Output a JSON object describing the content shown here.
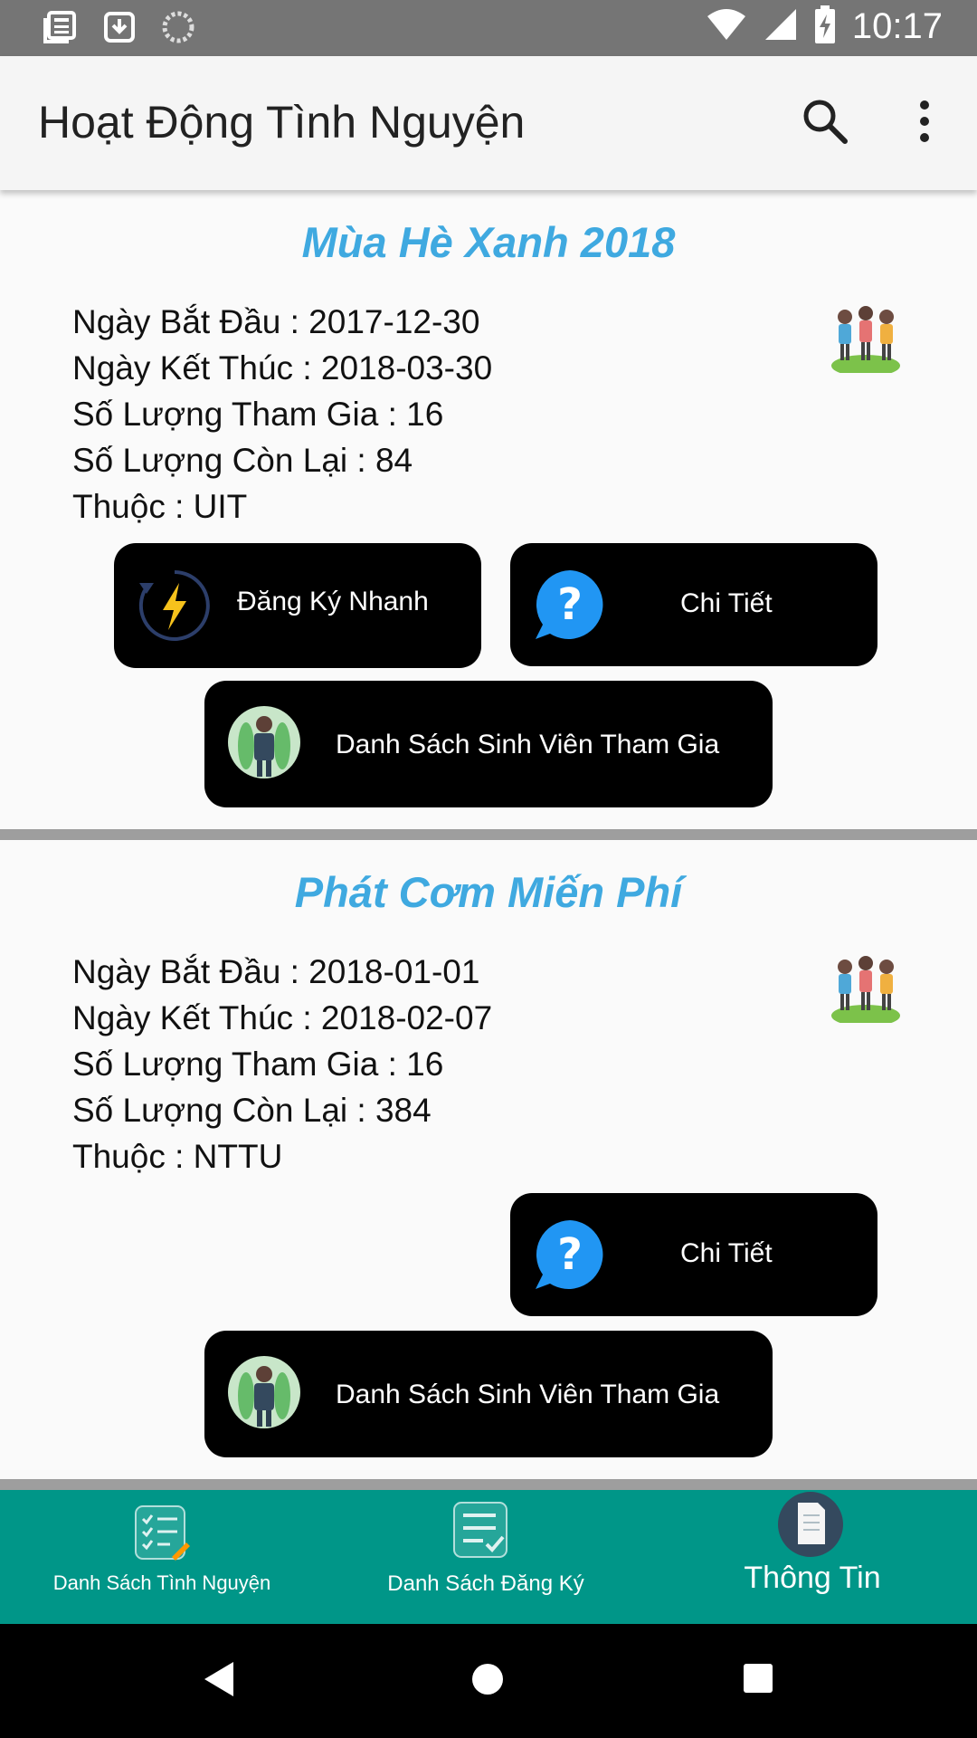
{
  "status_bar": {
    "time": "10:17",
    "icons": [
      "news-icon",
      "download-icon",
      "sync-icon",
      "wifi-icon",
      "signal-icon",
      "battery-charging-icon"
    ]
  },
  "app_bar": {
    "title": "Hoạt Động Tình Nguyện",
    "icons": [
      "search-icon",
      "more-vert-icon"
    ]
  },
  "activities": [
    {
      "title": "Mùa Hè Xanh 2018",
      "start": "Ngày Bắt Đầu : 2017-12-30",
      "end": "Ngày Kết Thúc : 2018-03-30",
      "joined": "Số Lượng Tham Gia : 16",
      "remaining": "Số Lượng Còn Lại : 84",
      "org": "Thuộc : UIT",
      "btn_quick_register": "Đăng Ký Nhanh",
      "btn_detail": "Chi Tiết",
      "btn_participants": "Danh Sách  Sinh Viên Tham Gia"
    },
    {
      "title": "Phát Cơm Miến Phí",
      "start": "Ngày Bắt Đầu : 2018-01-01",
      "end": "Ngày Kết Thúc : 2018-02-07",
      "joined": "Số Lượng Tham Gia : 16",
      "remaining": "Số Lượng Còn Lại : 384",
      "org": "Thuộc : NTTU",
      "btn_detail": "Chi Tiết",
      "btn_participants": "Danh Sách  Sinh Viên Tham Gia"
    }
  ],
  "bottom_nav": {
    "items": [
      {
        "label": "Danh Sách Tình Nguyện",
        "icon": "checklist-edit-icon"
      },
      {
        "label": "Danh Sách Đăng Ký",
        "icon": "checklist-icon"
      },
      {
        "label": "Thông Tin",
        "icon": "document-icon"
      }
    ]
  },
  "colors": {
    "accent": "#009688",
    "title_blue": "#3fa9e0",
    "status_bar": "#757575"
  }
}
